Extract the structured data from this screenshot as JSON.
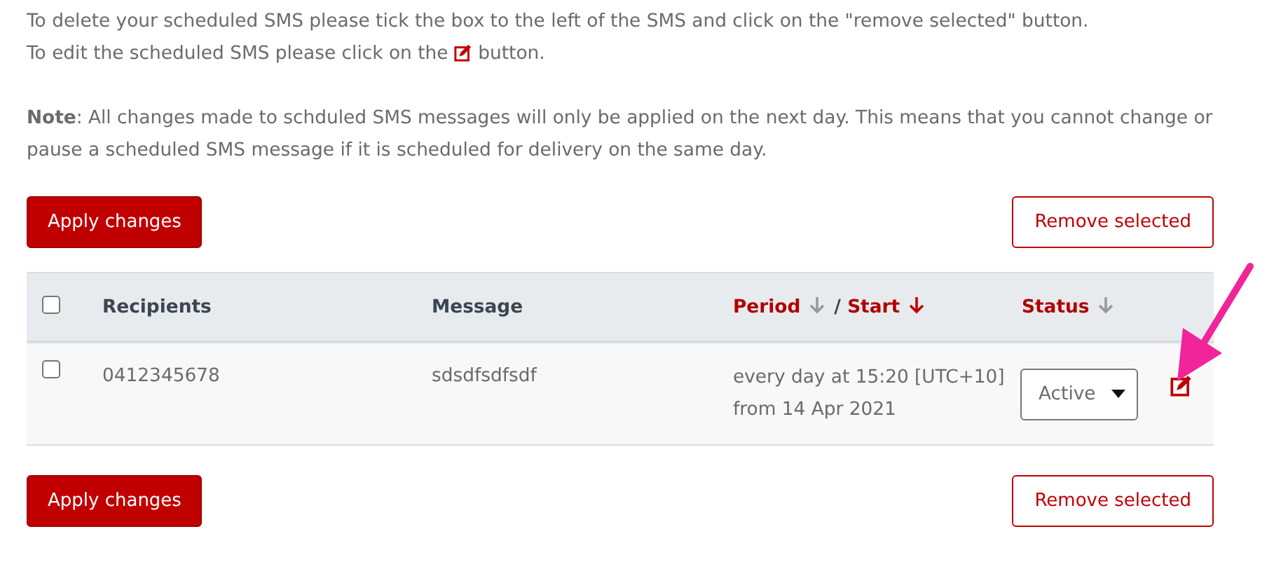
{
  "intro": {
    "delete_text": "To delete your scheduled SMS please tick the box to the left of the SMS and click on the \"remove selected\" button.",
    "edit_before": "To edit the scheduled SMS please click on the",
    "edit_after": "button.",
    "note": "**Note**: All changes made to schduled SMS messages will only be applied on the next day. This means that you cannot change or pause a scheduled SMS message if it is scheduled for delivery on the same day."
  },
  "button_bars": [
    {
      "apply": "Apply changes",
      "remove": "Remove selected"
    },
    {
      "apply": "Apply changes",
      "remove": "Remove selected"
    }
  ],
  "table": {
    "select_all": {
      "checked": false
    },
    "columns": [
      {
        "kind": "plain",
        "parts": [
          {
            "label": "Recipients"
          }
        ]
      },
      {
        "kind": "plain",
        "parts": [
          {
            "label": "Message"
          }
        ]
      },
      {
        "kind": "sortable",
        "parts": [
          {
            "label": "Period",
            "active": false
          },
          {
            "label": "Start",
            "active": true
          }
        ],
        "separator": "/"
      },
      {
        "kind": "sortable",
        "parts": [
          {
            "label": "Status",
            "active": false
          }
        ]
      }
    ],
    "rows": [
      {
        "checked": false,
        "recipients": "0412345678",
        "message": "sdsdfsdfsdf",
        "period": "every day at 15:20 [UTC+10]",
        "start": "from 14 Apr 2021",
        "status": "Active"
      }
    ]
  },
  "annotation": {
    "kind": "arrow"
  }
}
